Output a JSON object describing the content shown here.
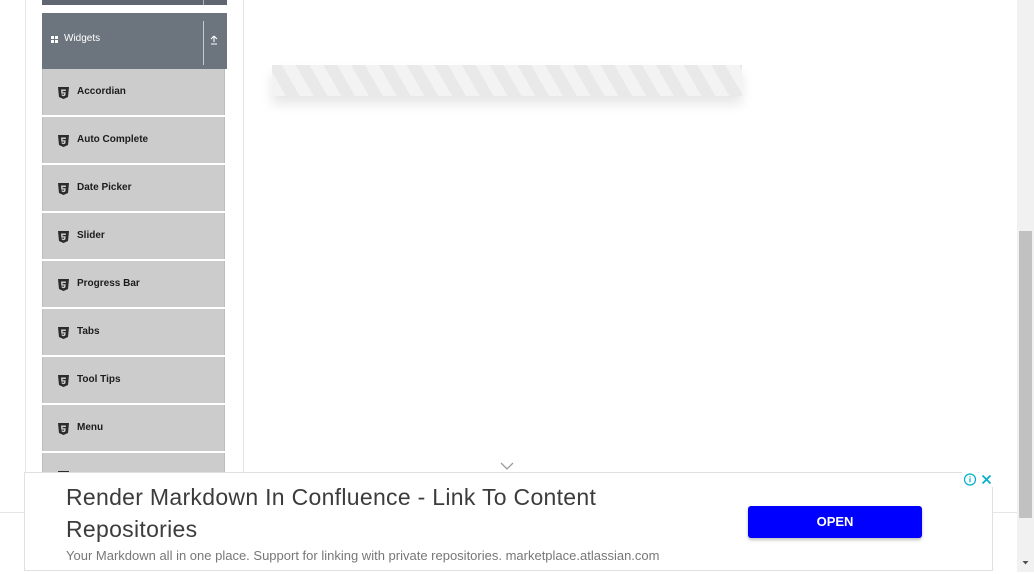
{
  "sidebar": {
    "group": {
      "title": "Widgets",
      "icon": "grid-icon",
      "toggle_icon": "collapse-up-icon"
    },
    "items": [
      {
        "label": "Accordian",
        "icon": "html5-icon"
      },
      {
        "label": "Auto Complete",
        "icon": "html5-icon"
      },
      {
        "label": "Date Picker",
        "icon": "html5-icon"
      },
      {
        "label": "Slider",
        "icon": "html5-icon"
      },
      {
        "label": "Progress Bar",
        "icon": "html5-icon"
      },
      {
        "label": "Tabs",
        "icon": "html5-icon"
      },
      {
        "label": "Tool Tips",
        "icon": "html5-icon"
      },
      {
        "label": "Menu",
        "icon": "html5-icon"
      },
      {
        "label": "",
        "icon": "html5-icon"
      }
    ]
  },
  "ad": {
    "headline": "Render Markdown In Confluence - Link To Content Repositories",
    "description": "Your Markdown all in one place. Support for linking with private repositories. marketplace.atlassian.com",
    "button_label": "OPEN"
  },
  "colors": {
    "group_header_bg": "#6c757d",
    "menu_item_bg": "#cccccc",
    "ad_button_bg": "#0000ff"
  }
}
